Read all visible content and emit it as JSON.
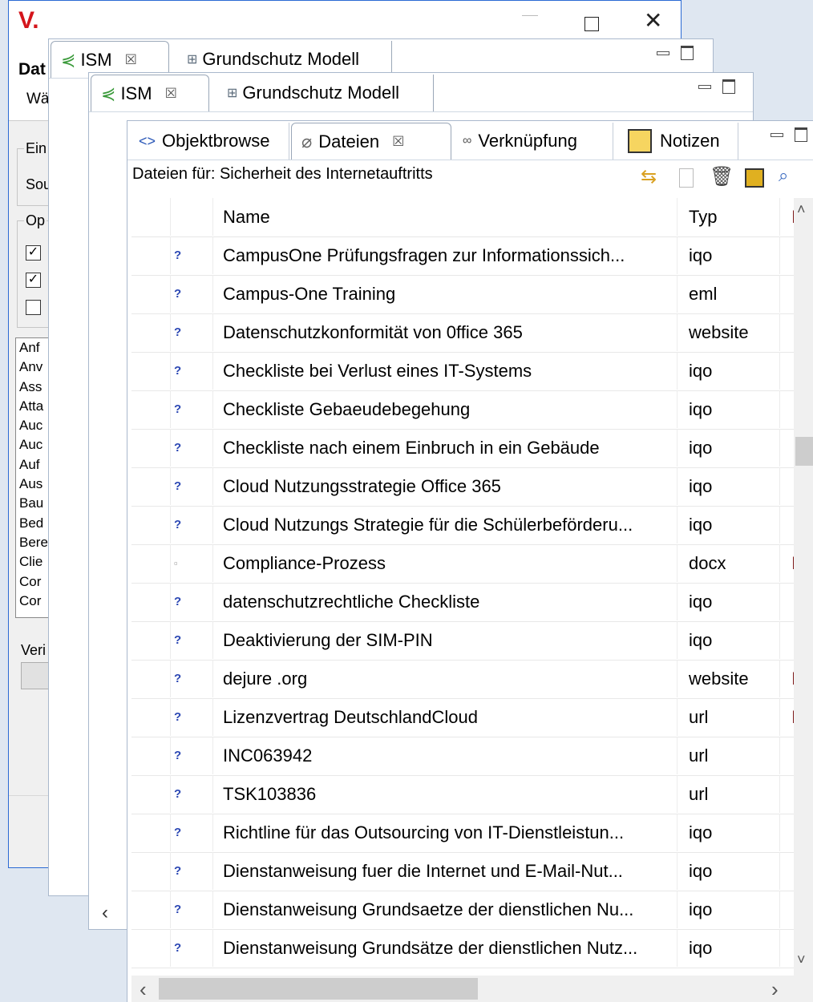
{
  "dialog": {
    "logo": "V.",
    "title_partial": "Dat",
    "subtitle_partial": "Wä",
    "group1_label": "Ein",
    "group1_row": "Sou",
    "group2_label": "Op",
    "checkboxes": [
      {
        "checked": true,
        "mark": "✓"
      },
      {
        "checked": true,
        "mark": "✓"
      },
      {
        "checked": false,
        "mark": ""
      }
    ],
    "list_items": [
      "Anf",
      "Anv",
      "Ass",
      "Atta",
      "Auc",
      "Auc",
      "Auf",
      "Aus",
      "Bau",
      "Bed",
      "Bere",
      "Clie",
      "Cor",
      "Cor"
    ],
    "verify_label": "Veri"
  },
  "views": {
    "ism_tab": "ISM",
    "grundschutz_tab": "Grundschutz Modell"
  },
  "files_view": {
    "tabs": [
      {
        "label": "Objektbrowse",
        "icon": "code-brackets-icon"
      },
      {
        "label": "Dateien",
        "icon": "paperclip-icon",
        "active": true
      },
      {
        "label": "Verknüpfung",
        "icon": "link-icon"
      },
      {
        "label": "Notizen",
        "icon": "note-pencil-icon"
      }
    ],
    "heading": "Dateien für: Sicherheit des Internetauftritts",
    "columns": {
      "icon": "",
      "name": "Name",
      "type": "Typ",
      "extra": "I"
    },
    "rows": [
      {
        "icon": "?",
        "name": "CampusOne Prüfungsfragen zur Informationssich...",
        "type": "iqo",
        "extra": ""
      },
      {
        "icon": "?",
        "name": "Campus-One Training",
        "type": "eml",
        "extra": ""
      },
      {
        "icon": "?",
        "name": "Datenschutzkonformität von 0ffice 365",
        "type": "website",
        "extra": ""
      },
      {
        "icon": "?",
        "name": "Checkliste bei Verlust eines IT-Systems",
        "type": "iqo",
        "extra": ""
      },
      {
        "icon": "?",
        "name": "Checkliste Gebaeudebegehung",
        "type": "iqo",
        "extra": ""
      },
      {
        "icon": "?",
        "name": "Checkliste nach einem Einbruch in ein Gebäude",
        "type": "iqo",
        "extra": ""
      },
      {
        "icon": "?",
        "name": "Cloud Nutzungsstrategie Office 365",
        "type": "iqo",
        "extra": ""
      },
      {
        "icon": "?",
        "name": "Cloud Nutzungs Strategie für die Schülerbeförderu...",
        "type": "iqo",
        "extra": ""
      },
      {
        "icon": "▫",
        "name": "Compliance-Prozess",
        "type": "docx",
        "extra": "I"
      },
      {
        "icon": "?",
        "name": "datenschutzrechtliche Checkliste",
        "type": "iqo",
        "extra": ""
      },
      {
        "icon": "?",
        "name": "Deaktivierung der SIM-PIN",
        "type": "iqo",
        "extra": ""
      },
      {
        "icon": "?",
        "name": "dejure .org",
        "type": "website",
        "extra": "I"
      },
      {
        "icon": "?",
        "name": "Lizenzvertrag DeutschlandCloud",
        "type": "url",
        "extra": "I"
      },
      {
        "icon": "?",
        "name": "INC063942",
        "type": "url",
        "extra": ""
      },
      {
        "icon": "?",
        "name": "TSK103836",
        "type": "url",
        "extra": ""
      },
      {
        "icon": "?",
        "name": "Richtline für das Outsourcing von IT-Dienstleistun...",
        "type": "iqo",
        "extra": ""
      },
      {
        "icon": "?",
        "name": "Dienstanweisung fuer die Internet und E-Mail-Nut...",
        "type": "iqo",
        "extra": ""
      },
      {
        "icon": "?",
        "name": "Dienstanweisung Grundsaetze der dienstlichen Nu...",
        "type": "iqo",
        "extra": ""
      },
      {
        "icon": "?",
        "name": "Dienstanweisung Grundsätze der dienstlichen Nutz...",
        "type": "iqo",
        "extra": ""
      }
    ]
  },
  "glyphs": {
    "close": "✕",
    "tab_close": "☒",
    "scroll_left": "‹",
    "scroll_right": "›",
    "scroll_up": "˄",
    "scroll_down": "˅"
  },
  "colors": {
    "brand_red": "#d4141b",
    "help_icon_blue": "#2b47b3",
    "panel_border": "#a9b8cc"
  }
}
